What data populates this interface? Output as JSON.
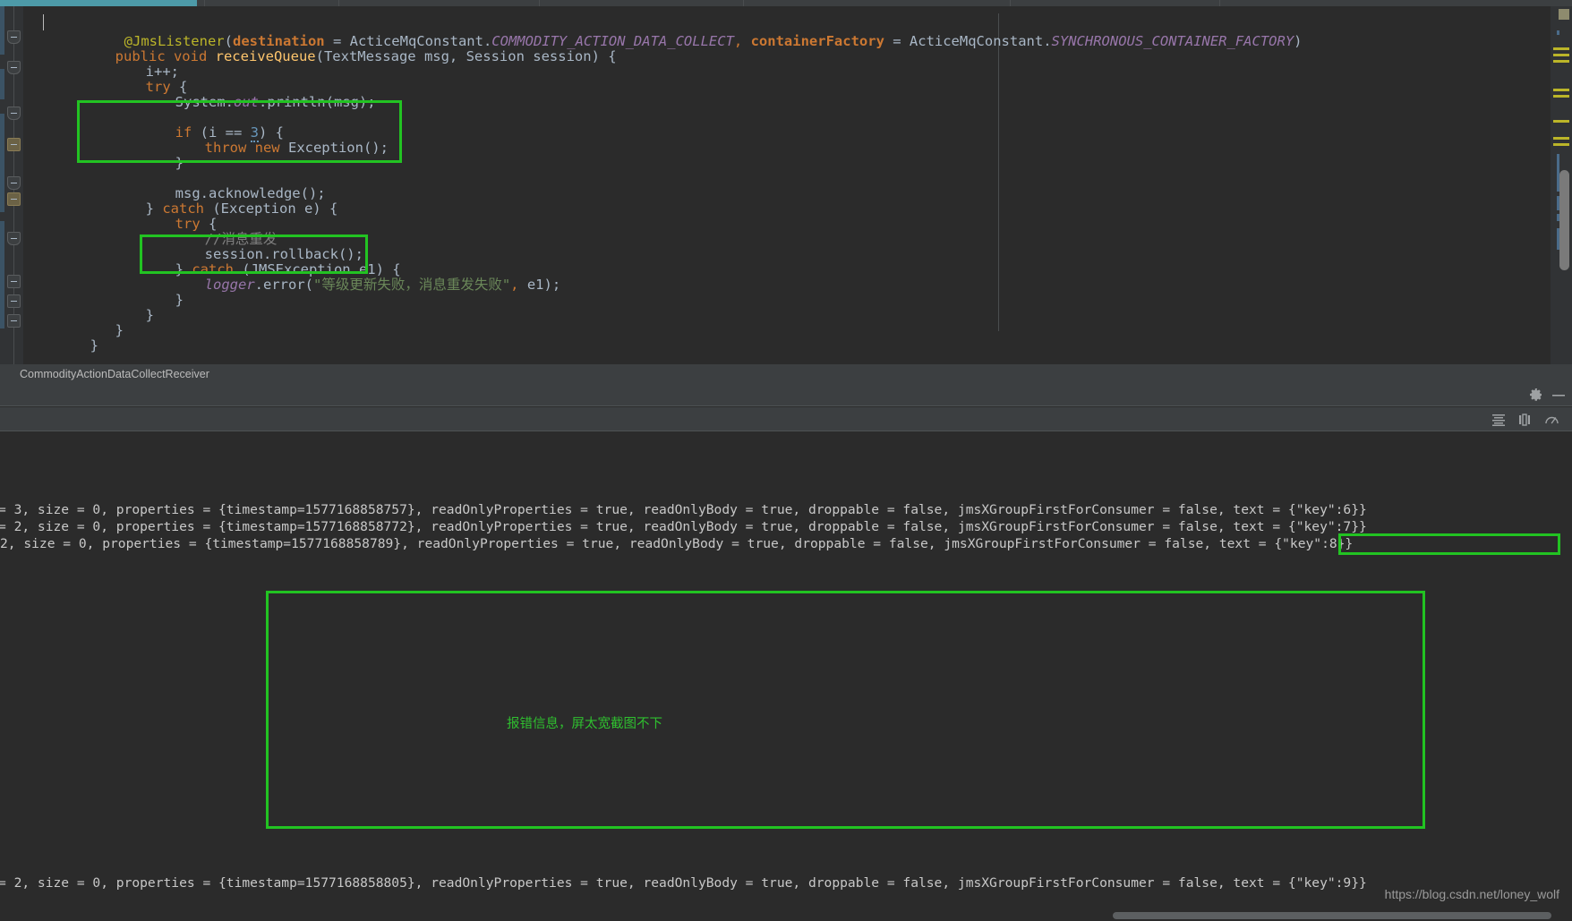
{
  "window": {
    "theme_bg": "#2b2b2b",
    "panel_bg": "#3c3f41",
    "accent": "#4d9aa8",
    "annotation_color": "#22c322"
  },
  "editor": {
    "caret_visible": true,
    "code_lines": [
      "@JmsListener(destination = ActiceMqConstant.COMMODITY_ACTION_DATA_COLLECT, containerFactory = ActiceMqConstant.SYNCHRONOUS_CONTAINER_FACTORY)",
      "public void receiveQueue(TextMessage msg, Session session) {",
      "    i++;",
      "    try {",
      "        System.out.println(msg);",
      "",
      "        if (i == 3) {",
      "            throw new Exception();",
      "        }",
      "",
      "        msg.acknowledge();",
      "    } catch (Exception e) {",
      "        try {",
      "            //消息重发",
      "            session.rollback();",
      "        } catch (JMSException e1) {",
      "            logger.error(\"等级更新失败，消息重发失败\", e1);",
      "        }",
      "    }",
      "}",
      "}"
    ],
    "annotation_box_1_label": "if-throw-exception-highlight",
    "annotation_box_2_label": "session-rollback-highlight"
  },
  "breadcrumb": {
    "text": "CommodityActionDataCollectReceiver"
  },
  "console_toolbar": {
    "icons": [
      {
        "name": "gear-icon",
        "title": "Settings"
      },
      {
        "name": "minimize-icon",
        "title": "Hide"
      },
      {
        "name": "soft-wrap-icon",
        "title": "Soft-Wrap"
      },
      {
        "name": "print-icon",
        "title": "Print"
      },
      {
        "name": "gauge-icon",
        "title": "Scroll to end"
      }
    ]
  },
  "console": {
    "lines": [
      "= 3, size = 0, properties = {timestamp=1577168858757}, readOnlyProperties = true, readOnlyBody = true, droppable = false, jmsXGroupFirstForConsumer = false, text = {\"key\":6}}",
      "= 2, size = 0, properties = {timestamp=1577168858772}, readOnlyProperties = true, readOnlyBody = true, droppable = false, jmsXGroupFirstForConsumer = false, text = {\"key\":7}}",
      "2, size = 0, properties = {timestamp=1577168858789}, readOnlyProperties = true, readOnlyBody = true, droppable = false, jmsXGroupFirstForConsumer = false, text = {\"key\":8}}"
    ],
    "last_line": "= 2, size = 0, properties = {timestamp=1577168858805}, readOnlyProperties = true, readOnlyBody = true, droppable = false, jmsXGroupFirstForConsumer = false, text = {\"key\":9}}",
    "annotation_note": "报错信息，屏太宽截图不下",
    "key8_highlight_label": "key8-highlight"
  },
  "watermark": {
    "text": "https://blog.csdn.net/loney_wolf"
  }
}
